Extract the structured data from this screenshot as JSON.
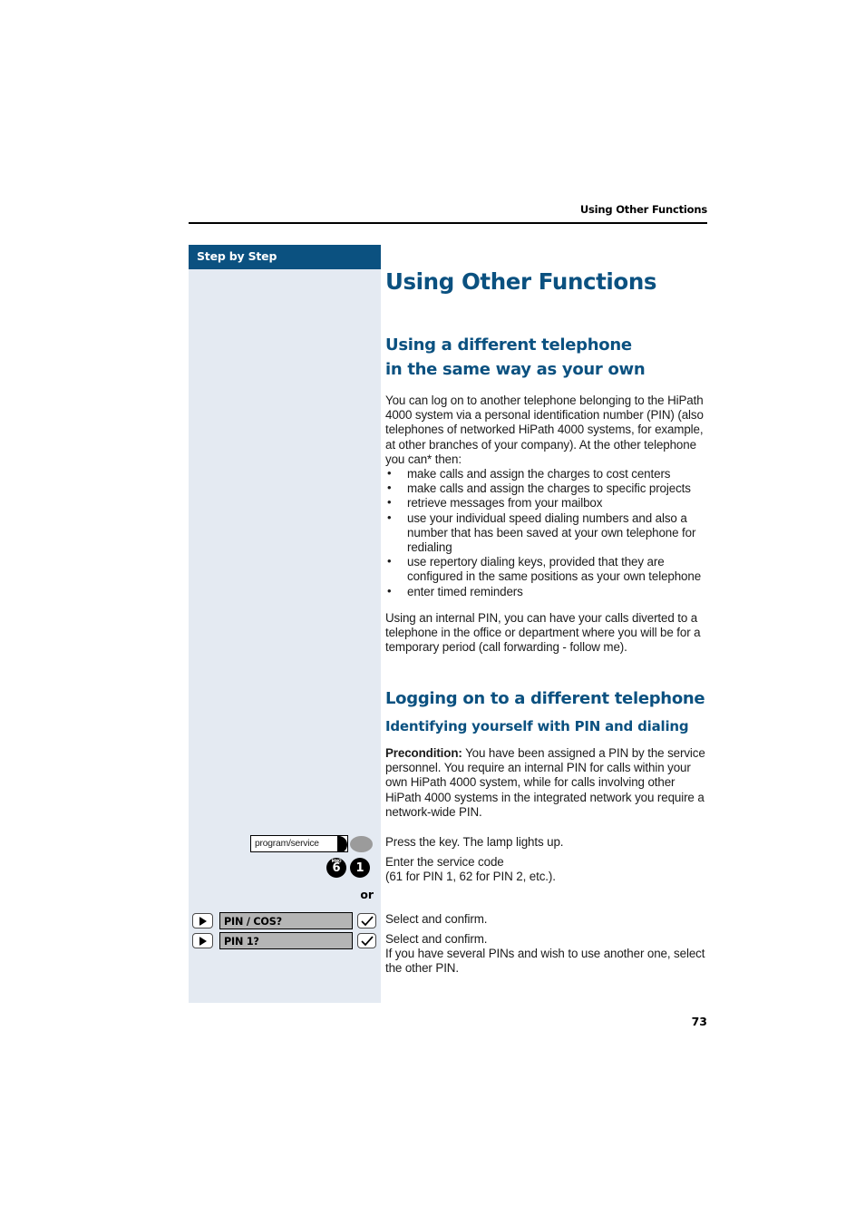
{
  "page": {
    "running_header": "Using Other Functions",
    "page_number": "73"
  },
  "sidebar": {
    "title": "Step by Step",
    "or_label": "or",
    "keys": {
      "program_service": {
        "label": "program/service",
        "lamp_color": "#9b9b9b"
      },
      "digits": [
        {
          "number": "6",
          "letters": "MNO"
        },
        {
          "number": "1",
          "letters": ""
        }
      ]
    },
    "menu_rows": [
      {
        "display": "PIN / COS?",
        "left_icon": "rocker-arrow-icon",
        "right_icon": "confirm-check-icon"
      },
      {
        "display": "PIN 1?",
        "left_icon": "rocker-arrow-icon",
        "right_icon": "confirm-check-icon"
      }
    ]
  },
  "main": {
    "h1": "Using Other Functions",
    "section1": {
      "heading_line1": "Using a different telephone",
      "heading_line2": "in the same way as your own",
      "intro": "You can log on to another telephone belonging to the HiPath 4000 system via a personal identification number (PIN) (also telephones of networked HiPath 4000 systems, for example, at other branches of your company). At the other telephone you can* then:",
      "bullets": [
        "make calls and assign the charges to cost centers",
        "make calls and assign the charges to specific projects",
        "retrieve messages from your mailbox",
        "use your individual speed dialing numbers and also a number that has been saved at your own telephone for redialing",
        "use repertory dialing keys, provided that they are configured in the same positions as your own telephone",
        "enter timed reminders"
      ],
      "outro": "Using an internal PIN, you can have your calls diverted to a telephone in the office or department where you will be for a temporary period (call forwarding - follow me)."
    },
    "section2": {
      "heading": "Logging on to a different telephone",
      "subheading": "Identifying yourself with PIN and dialing",
      "precondition_label": "Precondition:",
      "precondition_text": " You have been assigned a PIN by the service personnel. You require an internal PIN for calls within your own HiPath 4000 system, while for calls involving other HiPath 4000 systems in the integrated network you require a network-wide PIN.",
      "steps": [
        {
          "text": "Press the key. The lamp lights up."
        },
        {
          "text": "Enter the service code\n(61 for PIN 1, 62 for PIN 2, etc.)."
        },
        {
          "text": "Select and confirm."
        },
        {
          "text": "Select and confirm.\nIf you have several PINs and wish to use another one, select the other PIN."
        }
      ]
    }
  },
  "colors": {
    "brand_blue": "#0b5180",
    "sidebar_bg": "#e4eaf2",
    "display_gray": "#b5b5b5"
  }
}
